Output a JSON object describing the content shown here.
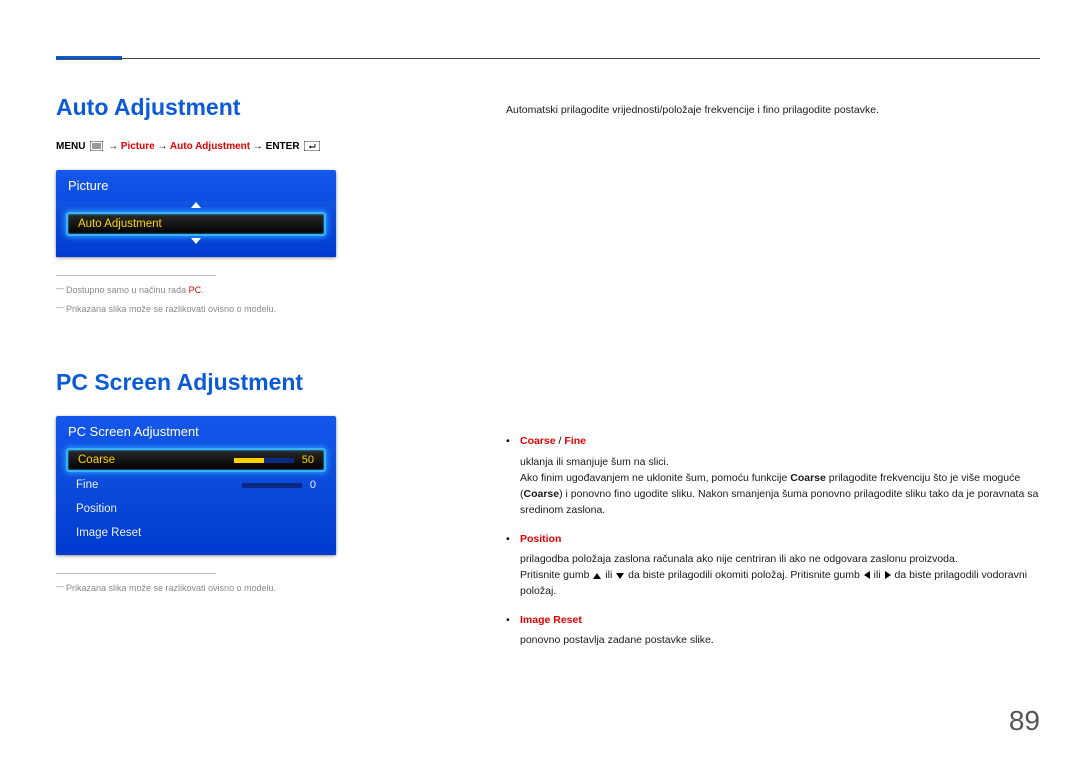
{
  "page_number": "89",
  "section1": {
    "title": "Auto Adjustment",
    "breadcrumb": {
      "menu": "MENU",
      "arrow": "→",
      "p1": "Picture",
      "p2": "Auto Adjustment",
      "enter": "ENTER"
    },
    "osd": {
      "title": "Picture",
      "selected_label": "Auto Adjustment"
    },
    "notes": {
      "n1_a": "Dostupno samo u načinu rada ",
      "n1_b": "PC",
      "n1_c": ".",
      "n2": "Prikazana slika može se razlikovati ovisno o modelu."
    },
    "lead": "Automatski prilagodite vrijednosti/položaje frekvencije i fino prilagodite postavke."
  },
  "section2": {
    "title": "PC Screen Adjustment",
    "osd": {
      "title": "PC Screen Adjustment",
      "rows": [
        {
          "label": "Coarse",
          "value": "50",
          "fill_pct": 50,
          "selected": true
        },
        {
          "label": "Fine",
          "value": "0",
          "fill_pct": 0,
          "selected": false
        },
        {
          "label": "Position",
          "value": "",
          "fill_pct": null,
          "selected": false
        },
        {
          "label": "Image Reset",
          "value": "",
          "fill_pct": null,
          "selected": false
        }
      ]
    },
    "note": "Prikazana slika može se razlikovati ovisno o modelu.",
    "bullets": {
      "b1": {
        "title_a": "Coarse",
        "slash": " / ",
        "title_b": "Fine",
        "line1": "uklanja ili smanjuje šum na slici.",
        "line2a": "Ako finim ugođavanjem ne uklonite šum, pomoću funkcije ",
        "line2b": "Coarse",
        "line2c": " prilagodite frekvenciju što je više moguće (",
        "line2d": "Coarse",
        "line2e": ") i ponovno fino ugodite sliku. Nakon smanjenja šuma ponovno prilagodite sliku tako da je poravnata sa sredinom zaslona."
      },
      "b2": {
        "title": "Position",
        "line1": "prilagodba položaja zaslona računala ako nije centriran ili ako ne odgovara zaslonu proizvoda.",
        "line2a": "Pritisnite gumb ",
        "line2b": " ili ",
        "line2c": " da biste prilagodili okomiti položaj. Pritisnite gumb ",
        "line2d": " ili ",
        "line2e": " da biste prilagodili vodoravni položaj."
      },
      "b3": {
        "title": "Image Reset",
        "line1": "ponovno postavlja zadane postavke slike."
      }
    }
  }
}
